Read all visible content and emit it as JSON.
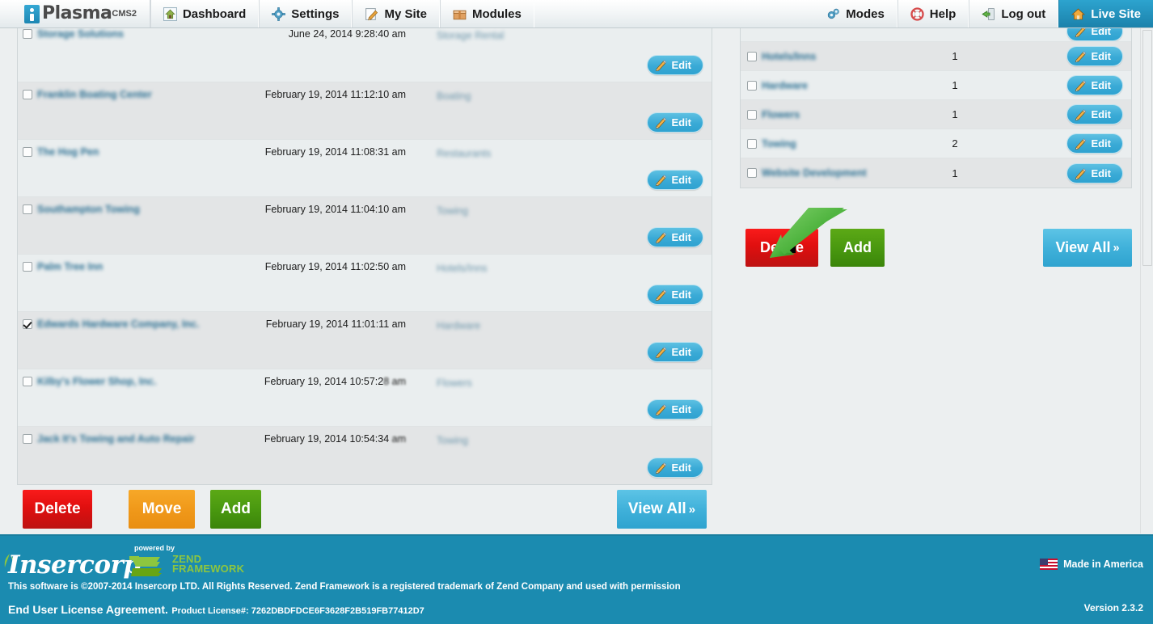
{
  "topnav": {
    "brand": {
      "name": "Plasma",
      "sup": "CMS2"
    },
    "left_items": [
      {
        "label": "Dashboard",
        "icon": "house-icon"
      },
      {
        "label": "Settings",
        "icon": "gear-icon"
      },
      {
        "label": "My Site",
        "icon": "pencil-note-icon"
      },
      {
        "label": "Modules",
        "icon": "box-icon"
      }
    ],
    "right_items": [
      {
        "label": "Modes",
        "icon": "gears-icon",
        "active": false
      },
      {
        "label": "Help",
        "icon": "lifering-icon",
        "active": false
      },
      {
        "label": "Log out",
        "icon": "exit-door-icon",
        "active": false
      },
      {
        "label": "Live Site",
        "icon": "home-icon",
        "active": true
      }
    ]
  },
  "listings": {
    "rows": [
      {
        "name": "Storage Solutions",
        "date": "June 24, 2014 9:28:40 am",
        "date_tail": "",
        "category": "Storage Rental",
        "checked": false,
        "edit": "Edit"
      },
      {
        "name": "Franklin Boating Center",
        "date": "February 19, 2014 11:12:10 am",
        "date_tail": "",
        "category": "Boating",
        "checked": false,
        "edit": "Edit"
      },
      {
        "name": "The Hog Pen",
        "date": "February 19, 2014 11:08:31 am",
        "date_tail": "",
        "category": "Restaurants",
        "checked": false,
        "edit": "Edit"
      },
      {
        "name": "Southampton Towing",
        "date": "February 19, 2014 11:04:10 am",
        "date_tail": "",
        "category": "Towing",
        "checked": false,
        "edit": "Edit"
      },
      {
        "name": "Palm Tree Inn",
        "date": "February 19, 2014 11:02:50 am",
        "date_tail": "",
        "category": "Hotels/Inns",
        "checked": false,
        "edit": "Edit"
      },
      {
        "name": "Edwards Hardware Company, Inc.",
        "date": "February 19, 2014 11:01:11 am",
        "date_tail": "",
        "category": "Hardware",
        "checked": true,
        "edit": "Edit"
      },
      {
        "name": "Kilby's Flower Shop, Inc.",
        "date": "February 19, 2014 10:57:2",
        "date_tail": "8 am",
        "category": "Flowers",
        "checked": false,
        "edit": "Edit"
      },
      {
        "name": "Jack It's Towing and Auto Repair",
        "date": "February 19, 2014 10:54:34",
        "date_tail": " am",
        "category": "Towing",
        "checked": false,
        "edit": "Edit"
      }
    ],
    "actions": {
      "delete": "Delete",
      "move": "Move",
      "add": "Add",
      "view_all": "View All",
      "view_all_chevron": "»"
    }
  },
  "categories": {
    "rows": [
      {
        "name": "",
        "count": "",
        "checked": false,
        "edit": "Edit",
        "clipped": true
      },
      {
        "name": "Hotels/Inns",
        "count": "1",
        "checked": false,
        "edit": "Edit",
        "clipped": false
      },
      {
        "name": "Hardware",
        "count": "1",
        "checked": false,
        "edit": "Edit",
        "clipped": false
      },
      {
        "name": "Flowers",
        "count": "1",
        "checked": false,
        "edit": "Edit",
        "clipped": false
      },
      {
        "name": "Towing",
        "count": "2",
        "checked": false,
        "edit": "Edit",
        "clipped": false
      },
      {
        "name": "Website Development",
        "count": "1",
        "checked": false,
        "edit": "Edit",
        "clipped": false
      }
    ],
    "actions": {
      "delete": "Delete",
      "add": "Add",
      "view_all": "View All",
      "view_all_chevron": "»"
    }
  },
  "annotation": {
    "kind": "green-arrow",
    "points_at": "Delete",
    "color": "#3faa35"
  },
  "footer": {
    "company": "Insercorp",
    "powered_by": "powered by",
    "zend_line1": "ZEND",
    "zend_line2": "FRAMEWORK",
    "copyright": "This software is ©2007-2014 Insercorp LTD. All Rights Reserved. Zend Framework is a registered trademark of Zend Company and used with permission",
    "eula": "End User License Agreement.",
    "license_label": "Product License#: 7262DBDFDCE6F3628F2B519FB77412D7",
    "made_in_america": "Made in America",
    "version": "Version 2.3.2"
  },
  "colors": {
    "accent": "#2ea2d0",
    "footer_bg": "#1b8bb0",
    "delete": "#e00f0f",
    "move": "#f0991a",
    "add": "#48970f",
    "arrow": "#3faa35"
  }
}
